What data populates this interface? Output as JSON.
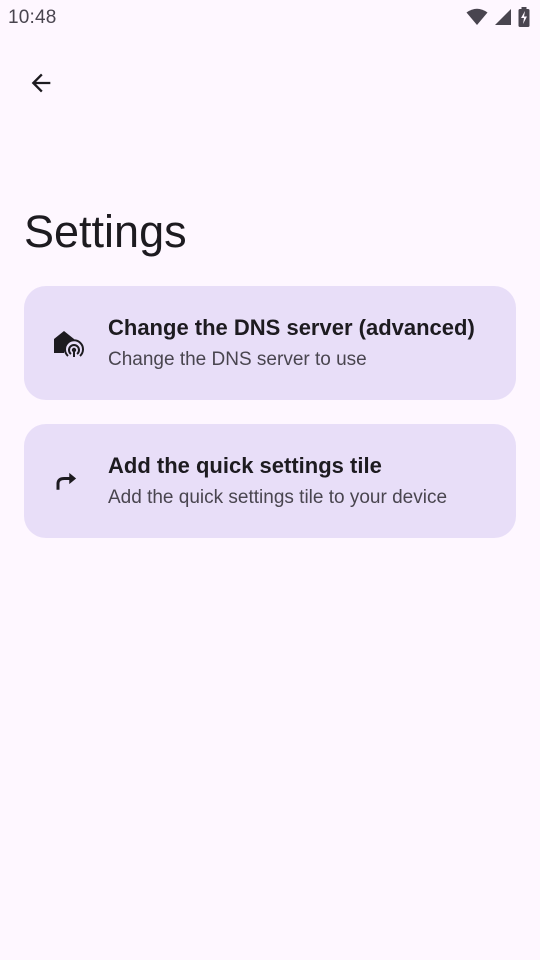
{
  "status_bar": {
    "time": "10:48",
    "icons": [
      "wifi-icon",
      "cell-signal-icon",
      "battery-charging-icon"
    ]
  },
  "header": {
    "back_icon": "arrow-back-icon",
    "title": "Settings"
  },
  "settings": [
    {
      "icon": "dns-router-icon",
      "title": "Change the DNS server (advanced)",
      "subtitle": "Change the DNS server to use"
    },
    {
      "icon": "share-forward-icon",
      "title": "Add the quick settings tile",
      "subtitle": "Add the quick settings tile to your device"
    }
  ],
  "colors": {
    "background": "#fef7ff",
    "card": "#e8def8",
    "text_primary": "#1d1b20",
    "text_secondary": "#49454f"
  }
}
